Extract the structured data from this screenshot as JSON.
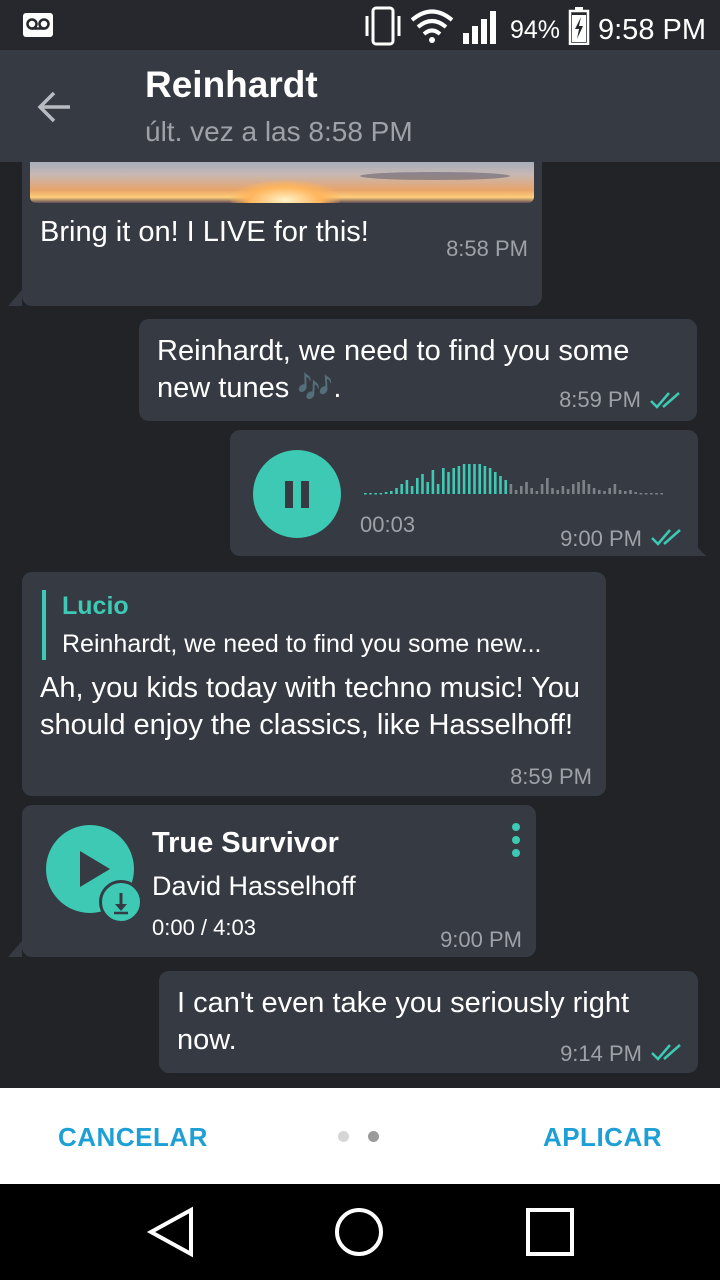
{
  "status_bar": {
    "battery_percent": "94%",
    "time": "9:58 PM"
  },
  "header": {
    "title": "Reinhardt",
    "subtitle": "últ. vez a las 8:58 PM"
  },
  "messages": [
    {
      "text": "Bring it on! I LIVE for this!",
      "time": "8:58 PM"
    },
    {
      "text": "Reinhardt, we need to find you some new tunes 🎶.",
      "time": "8:59 PM"
    },
    {
      "duration": "00:03",
      "time": "9:00 PM"
    },
    {
      "reply_author": "Lucio",
      "reply_text": "Reinhardt, we need to find you some new...",
      "text": "Ah, you kids today with techno music! You should enjoy the classics, like Hasselhoff!",
      "time": "8:59 PM"
    },
    {
      "track_title": "True Survivor",
      "artist": "David Hasselhoff",
      "progress": "0:00 / 4:03",
      "time": "9:00 PM"
    },
    {
      "text": "I can't even take you seriously right now.",
      "time": "9:14 PM"
    }
  ],
  "footer": {
    "cancel_label": "CANCELAR",
    "apply_label": "APLICAR"
  },
  "colors": {
    "accent": "#3dc9b3",
    "link": "#1e9fd6",
    "bubble": "#363a42",
    "background": "#222327"
  }
}
